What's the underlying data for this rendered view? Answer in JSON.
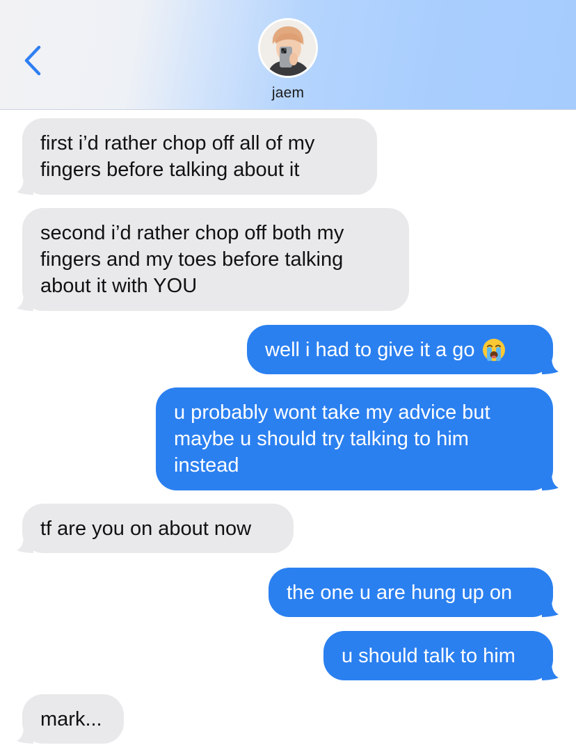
{
  "header": {
    "contact_name": "jaem",
    "back_icon": "chevron-left-icon",
    "avatar_icon": "avatar-photo"
  },
  "colors": {
    "incoming_bubble": "#e9e9eb",
    "outgoing_bubble": "#2b80f0",
    "accent": "#2f7ff2"
  },
  "messages": [
    {
      "direction": "incoming",
      "lines": [
        "first i’d rather chop off all of my",
        "fingers before talking about it"
      ]
    },
    {
      "direction": "incoming",
      "lines": [
        "second i’d rather chop off both my",
        "fingers and my toes before talking",
        "about it with YOU"
      ]
    },
    {
      "direction": "outgoing",
      "lines": [
        "well i had to give it a go"
      ],
      "emoji": "loudly-crying-face-icon"
    },
    {
      "direction": "outgoing",
      "lines": [
        "u probably wont take my advice but",
        "maybe u should try talking to him",
        "instead"
      ]
    },
    {
      "direction": "incoming",
      "lines": [
        "tf are you on about now"
      ]
    },
    {
      "direction": "outgoing",
      "lines": [
        "the one u are hung up on"
      ]
    },
    {
      "direction": "outgoing",
      "lines": [
        "u should talk to him"
      ]
    },
    {
      "direction": "incoming",
      "lines": [
        "mark..."
      ]
    }
  ]
}
